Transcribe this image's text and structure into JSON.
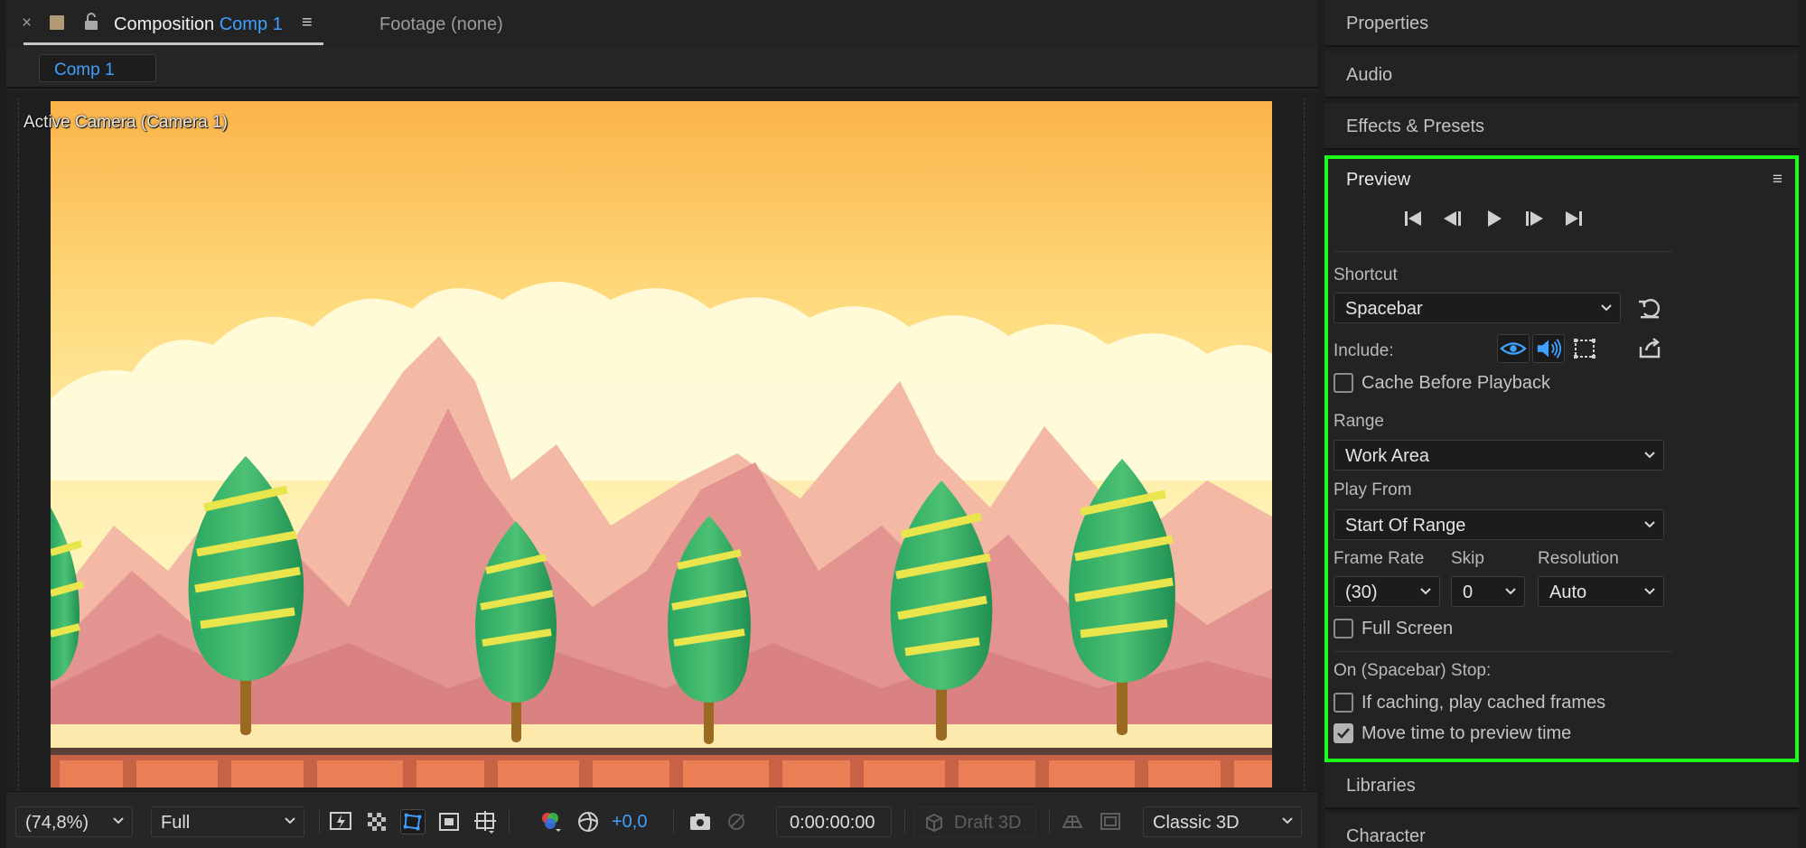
{
  "composition_panel": {
    "tab": {
      "prefix": "Composition",
      "comp_name": "Comp 1",
      "close_glyph": "×",
      "menu_glyph": "≡"
    },
    "footage_tab": "Footage (none)",
    "comp_chip": "Comp 1",
    "camera_label": "Active Camera (Camera 1)"
  },
  "bottom_bar": {
    "zoom": "(74,8%)",
    "resolution": "Full",
    "exposure": "+0,0",
    "timecode": "0:00:00:00",
    "draft3d": "Draft 3D",
    "renderer": "Classic 3D"
  },
  "right_panels": {
    "top": [
      "Properties",
      "Audio",
      "Effects & Presets"
    ],
    "bottom": [
      "Libraries",
      "Character"
    ]
  },
  "preview": {
    "title": "Preview",
    "menu_glyph": "≡",
    "shortcut_label": "Shortcut",
    "shortcut_value": "Spacebar",
    "include_label": "Include:",
    "cache_before_playback": "Cache Before Playback",
    "range_label": "Range",
    "range_value": "Work Area",
    "play_from_label": "Play From",
    "play_from_value": "Start Of Range",
    "frame_rate_label": "Frame Rate",
    "frame_rate_value": "(30)",
    "skip_label": "Skip",
    "skip_value": "0",
    "resolution_label": "Resolution",
    "resolution_value": "Auto",
    "full_screen": "Full Screen",
    "on_stop_label": "On (Spacebar) Stop:",
    "if_caching": "If caching, play cached frames",
    "move_time": "Move time to preview time",
    "checks": {
      "cache_before_playback": false,
      "full_screen": false,
      "if_caching": false,
      "move_time": true
    }
  },
  "colors": {
    "accent_blue": "#3ea0ff",
    "highlight_green": "#1aff1a",
    "panel_bg": "#232323"
  },
  "icons": {
    "transport": [
      "skip-to-start-icon",
      "step-back-icon",
      "play-icon",
      "step-forward-icon",
      "skip-to-end-icon"
    ],
    "include": [
      "video-eye-icon",
      "audio-speaker-icon",
      "overlays-icon",
      "export-icon"
    ]
  }
}
